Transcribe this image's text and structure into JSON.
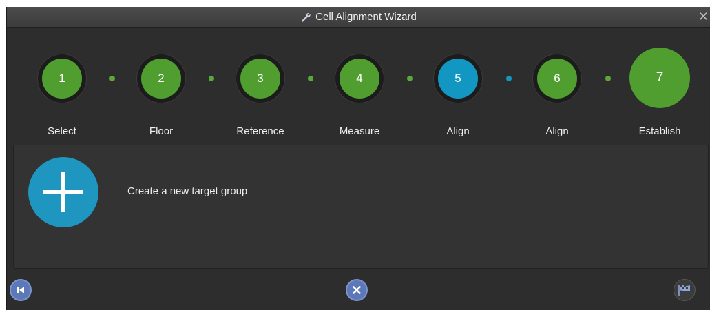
{
  "window": {
    "title": "Cell Alignment Wizard",
    "close_label": "✕"
  },
  "steps": [
    {
      "number": "1",
      "label": "Select",
      "state": "done"
    },
    {
      "number": "2",
      "label": "Floor",
      "state": "done"
    },
    {
      "number": "3",
      "label": "Reference",
      "state": "done"
    },
    {
      "number": "4",
      "label": "Measure",
      "state": "done"
    },
    {
      "number": "5",
      "label": "Align",
      "state": "active"
    },
    {
      "number": "6",
      "label": "Align",
      "state": "pending"
    },
    {
      "number": "7",
      "label": "Establish",
      "state": "final"
    }
  ],
  "panel": {
    "add_label": "Create a new target group",
    "add_icon": "plus-icon"
  },
  "footer": {
    "back_icon": "skip-back-icon",
    "cancel_icon": "cancel-icon",
    "finish_icon": "checkered-flag-icon"
  },
  "colors": {
    "green": "#4f9e2f",
    "blue": "#1297c2",
    "background": "#2d2d2d"
  }
}
